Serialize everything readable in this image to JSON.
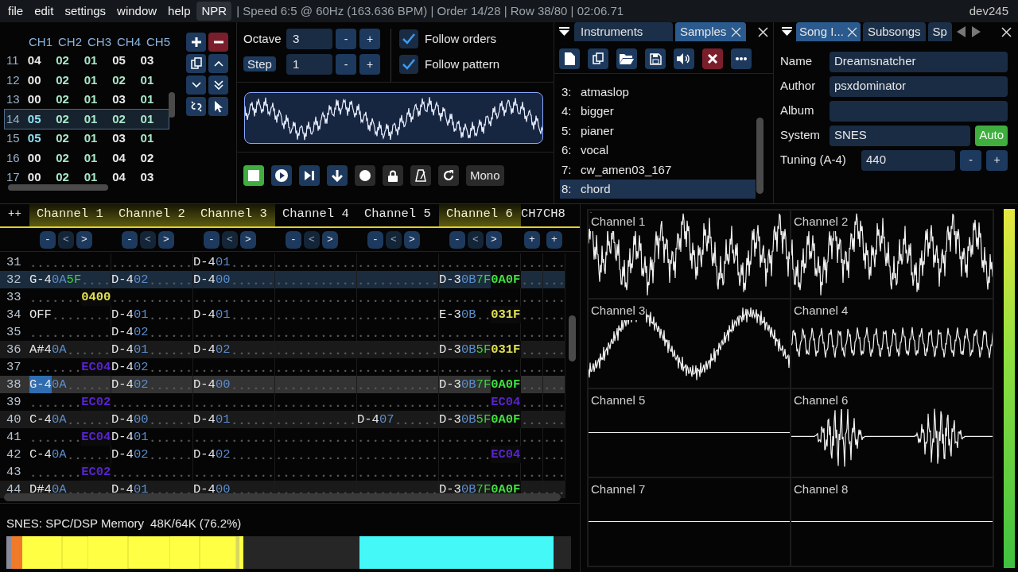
{
  "menu": [
    {
      "label": "file",
      "selected": false
    },
    {
      "label": "edit",
      "selected": false
    },
    {
      "label": "settings",
      "selected": false
    },
    {
      "label": "window",
      "selected": false
    },
    {
      "label": "help",
      "selected": false
    },
    {
      "label": "NPR",
      "selected": true
    }
  ],
  "status": "| Speed 6:5 @ 60Hz (163.636 BPM) | Order 14/28 | Row 38/80 | 02:06.71",
  "version": "dev245",
  "orders": {
    "columns": [
      "CH1",
      "CH2",
      "CH3",
      "CH4",
      "CH5"
    ],
    "rows": [
      {
        "label": "11",
        "selected": false,
        "values": [
          {
            "text": "04",
            "color": "#e8e8e8"
          },
          {
            "text": "02",
            "color": "#a8e6c8"
          },
          {
            "text": "01",
            "color": "#a8e6c8"
          },
          {
            "text": "05",
            "color": "#e8e8e8"
          },
          {
            "text": "03",
            "color": "#e8e8e8"
          }
        ]
      },
      {
        "label": "12",
        "selected": false,
        "values": [
          {
            "text": "00",
            "color": "#e8e8e8"
          },
          {
            "text": "02",
            "color": "#a8e6c8"
          },
          {
            "text": "01",
            "color": "#a8e6c8"
          },
          {
            "text": "02",
            "color": "#a8e6c8"
          },
          {
            "text": "01",
            "color": "#a8e6c8"
          }
        ]
      },
      {
        "label": "13",
        "selected": false,
        "values": [
          {
            "text": "00",
            "color": "#e8e8e8"
          },
          {
            "text": "02",
            "color": "#a8e6c8"
          },
          {
            "text": "01",
            "color": "#a8e6c8"
          },
          {
            "text": "03",
            "color": "#e8e8e8"
          },
          {
            "text": "01",
            "color": "#a8e6c8"
          }
        ]
      },
      {
        "label": "14",
        "selected": true,
        "values": [
          {
            "text": "05",
            "color": "#8ee0f0"
          },
          {
            "text": "02",
            "color": "#a8e6c8"
          },
          {
            "text": "01",
            "color": "#a8e6c8"
          },
          {
            "text": "02",
            "color": "#a8e6c8"
          },
          {
            "text": "01",
            "color": "#a8e6c8"
          }
        ]
      },
      {
        "label": "15",
        "selected": false,
        "values": [
          {
            "text": "05",
            "color": "#8ee0f0"
          },
          {
            "text": "02",
            "color": "#a8e6c8"
          },
          {
            "text": "01",
            "color": "#a8e6c8"
          },
          {
            "text": "03",
            "color": "#e8e8e8"
          },
          {
            "text": "01",
            "color": "#a8e6c8"
          }
        ]
      },
      {
        "label": "16",
        "selected": false,
        "values": [
          {
            "text": "00",
            "color": "#e8e8e8"
          },
          {
            "text": "02",
            "color": "#a8e6c8"
          },
          {
            "text": "01",
            "color": "#a8e6c8"
          },
          {
            "text": "04",
            "color": "#e8e8e8"
          },
          {
            "text": "02",
            "color": "#e8e8e8"
          }
        ]
      },
      {
        "label": "17",
        "selected": false,
        "values": [
          {
            "text": "00",
            "color": "#e8e8e8"
          },
          {
            "text": "02",
            "color": "#a8e6c8"
          },
          {
            "text": "01",
            "color": "#a8e6c8"
          },
          {
            "text": "04",
            "color": "#e8e8e8"
          },
          {
            "text": "03",
            "color": "#e8e8e8"
          }
        ]
      }
    ]
  },
  "editor": {
    "fields": [
      {
        "label": "Octave",
        "kind": "plain",
        "value": "3",
        "buttons": [
          "-",
          "+"
        ]
      },
      {
        "label": "Step",
        "kind": "button",
        "value": "1",
        "buttons": [
          "-",
          "+"
        ]
      }
    ],
    "checkboxes": [
      {
        "label": "Follow orders",
        "checked": true
      },
      {
        "label": "Follow pattern",
        "checked": true
      }
    ],
    "preview_wave": {
      "kind": "mixed"
    },
    "mono_label": "Mono"
  },
  "samples_panel": {
    "tabs": [
      {
        "label": "Instruments",
        "selected": false
      },
      {
        "label": "Samples",
        "selected": true
      }
    ],
    "items": [
      {
        "index": "3:",
        "name": "atmaslop",
        "selected": false
      },
      {
        "index": "4:",
        "name": "bigger",
        "selected": false
      },
      {
        "index": "5:",
        "name": "pianer",
        "selected": false
      },
      {
        "index": "6:",
        "name": "vocal",
        "selected": false
      },
      {
        "index": "7:",
        "name": "cw_amen03_167",
        "selected": false
      },
      {
        "index": "8:",
        "name": "chord",
        "selected": true
      }
    ]
  },
  "song_panel": {
    "tabs": [
      {
        "label": "Song I...",
        "selected": true
      },
      {
        "label": "Subsongs",
        "selected": false
      },
      {
        "label": "Sp",
        "selected": false
      }
    ],
    "fields": [
      {
        "label": "Name",
        "value": "Dreamsnatcher"
      },
      {
        "label": "Author",
        "value": "psxdominator"
      },
      {
        "label": "Album"
      },
      {
        "label": "System",
        "value": "SNES",
        "button": "Auto"
      },
      {
        "label": "Tuning (A-4)",
        "value": "440",
        "buttons": [
          "-",
          "+"
        ]
      }
    ]
  },
  "pattern": {
    "corner": "++",
    "channels": [
      {
        "name": "Channel 1",
        "kind": "full",
        "active": true,
        "buttons": [
          "-",
          "<",
          ">"
        ]
      },
      {
        "name": "Channel 2",
        "kind": "full",
        "active": true,
        "buttons": [
          "-",
          "<",
          ">"
        ]
      },
      {
        "name": "Channel 3",
        "kind": "full",
        "active": true,
        "buttons": [
          "-",
          "<",
          ">"
        ]
      },
      {
        "name": "Channel 4",
        "kind": "full",
        "active": false,
        "buttons": [
          "-",
          "<",
          ">"
        ]
      },
      {
        "name": "Channel 5",
        "kind": "full",
        "active": false,
        "buttons": [
          "-",
          "<",
          ">"
        ]
      },
      {
        "name": "Channel 6",
        "kind": "full",
        "active": true,
        "buttons": [
          "-",
          "<",
          ">"
        ]
      },
      {
        "name": "CH7",
        "kind": "collapsed",
        "active": false,
        "buttons": [
          "+"
        ]
      },
      {
        "name": "CH8",
        "kind": "collapsed",
        "active": false,
        "buttons": [
          "+"
        ]
      }
    ],
    "rows": [
      {
        "number": "31",
        "kind": "plain",
        "cells": [
          null,
          null,
          {
            "note": "D-4",
            "ins": "01"
          },
          null,
          null,
          null
        ]
      },
      {
        "number": "32",
        "kind": "bar",
        "cells": [
          {
            "note": "G-4",
            "ins": "0A",
            "vol": "5F"
          },
          {
            "note": "D-4",
            "ins": "02"
          },
          {
            "note": "D-4",
            "ins": "00"
          },
          null,
          null,
          {
            "note": "D-3",
            "ins": "0B",
            "vol": "7F",
            "fx": "0A0F",
            "color": "#40e040"
          }
        ]
      },
      {
        "number": "33",
        "kind": "plain",
        "cells": [
          {
            "fx": "0400",
            "color": "#e0e050"
          },
          null,
          null,
          null,
          null,
          null
        ]
      },
      {
        "number": "34",
        "kind": "plain",
        "cells": [
          {
            "note": "OFF"
          },
          {
            "note": "D-4",
            "ins": "01"
          },
          {
            "note": "D-4",
            "ins": "01"
          },
          null,
          null,
          {
            "note": "E-3",
            "ins": "0B",
            "fx": "031F",
            "color": "#e0e050"
          }
        ]
      },
      {
        "number": "35",
        "kind": "plain",
        "cells": [
          null,
          {
            "note": "D-4",
            "ins": "02"
          },
          null,
          null,
          null,
          null
        ]
      },
      {
        "number": "36",
        "kind": "beat",
        "cells": [
          {
            "note": "A#4",
            "ins": "0A"
          },
          {
            "note": "D-4",
            "ins": "01"
          },
          {
            "note": "D-4",
            "ins": "02"
          },
          null,
          null,
          {
            "note": "D-3",
            "ins": "0B",
            "vol": "5F",
            "fx": "031F",
            "color": "#e0e050"
          }
        ]
      },
      {
        "number": "37",
        "kind": "plain",
        "cells": [
          {
            "fx": "EC04",
            "color": "#5a22d0"
          },
          {
            "note": "D-4",
            "ins": "02"
          },
          null,
          null,
          null,
          null
        ]
      },
      {
        "number": "38",
        "kind": "cursor",
        "cells": [
          {
            "note": "G-4",
            "ins": "0A"
          },
          {
            "note": "D-4",
            "ins": "02"
          },
          {
            "note": "D-4",
            "ins": "00"
          },
          null,
          null,
          {
            "note": "D-3",
            "ins": "0B",
            "vol": "7F",
            "fx": "0A0F",
            "color": "#40e040"
          }
        ]
      },
      {
        "number": "39",
        "kind": "plain",
        "cells": [
          {
            "fx": "EC02",
            "color": "#5a22d0"
          },
          null,
          null,
          null,
          null,
          {
            "fx": "EC04",
            "color": "#5a22d0"
          }
        ]
      },
      {
        "number": "40",
        "kind": "beat",
        "cells": [
          {
            "note": "C-4",
            "ins": "0A"
          },
          {
            "note": "D-4",
            "ins": "00"
          },
          {
            "note": "D-4",
            "ins": "01"
          },
          null,
          {
            "note": "D-4",
            "ins": "07"
          },
          {
            "note": "D-3",
            "ins": "0B",
            "vol": "5F",
            "fx": "0A0F",
            "color": "#40e040"
          }
        ]
      },
      {
        "number": "41",
        "kind": "plain",
        "cells": [
          {
            "fx": "EC04",
            "color": "#5a22d0"
          },
          {
            "note": "D-4",
            "ins": "01"
          },
          null,
          null,
          null,
          null
        ]
      },
      {
        "number": "42",
        "kind": "plain",
        "cells": [
          {
            "note": "C-4",
            "ins": "0A"
          },
          {
            "note": "D-4",
            "ins": "02"
          },
          {
            "note": "D-4",
            "ins": "02"
          },
          null,
          null,
          {
            "fx": "EC04",
            "color": "#5a22d0"
          }
        ]
      },
      {
        "number": "43",
        "kind": "plain",
        "cells": [
          {
            "fx": "EC02",
            "color": "#5a22d0"
          },
          null,
          null,
          null,
          null,
          null
        ]
      },
      {
        "number": "44",
        "kind": "beat",
        "cells": [
          {
            "note": "D#4",
            "ins": "0A"
          },
          {
            "note": "D-4",
            "ins": "01"
          },
          {
            "note": "D-4",
            "ins": "00"
          },
          null,
          null,
          {
            "note": "D-3",
            "ins": "0B",
            "vol": "7F",
            "fx": "0A0F",
            "color": "#40e040"
          }
        ]
      }
    ]
  },
  "memory": {
    "title": "SNES: SPC/DSP Memory",
    "usage": "48K/64K (76.2%)"
  },
  "scopes": [
    {
      "label": "Channel 1",
      "kind": "noise"
    },
    {
      "label": "Channel 2",
      "kind": "noise"
    },
    {
      "label": "Channel 3",
      "kind": "smooth"
    },
    {
      "label": "Channel 4",
      "kind": "hum"
    },
    {
      "label": "Channel 5",
      "kind": "flat"
    },
    {
      "label": "Channel 6",
      "kind": "burst"
    },
    {
      "label": "Channel 7",
      "kind": "flat"
    },
    {
      "label": "Channel 8",
      "kind": "flat"
    }
  ],
  "meter": {
    "level": 1
  }
}
